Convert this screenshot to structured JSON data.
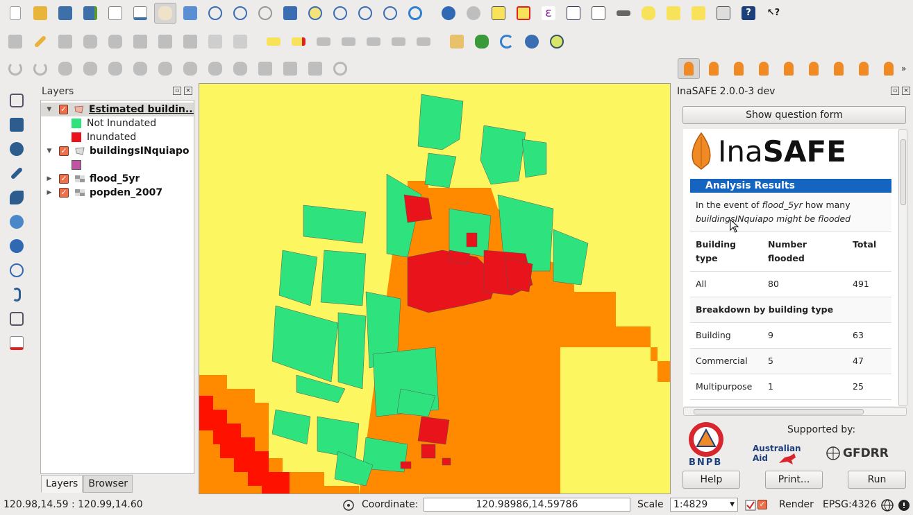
{
  "toolbar": {
    "row1": [
      "new-project-icon",
      "open-project-icon",
      "save-project-icon",
      "save-as-icon",
      "new-print-composer-icon",
      "composer-manager-icon",
      "pan-icon",
      "pan-to-selection-icon",
      "zoom-in-icon",
      "zoom-out-icon",
      "zoom-native-icon",
      "zoom-full-icon",
      "zoom-to-selection-icon",
      "zoom-to-layer-icon",
      "zoom-last-icon",
      "zoom-next-icon",
      "refresh-icon",
      "identify-icon",
      "action-icon",
      "select-features-icon",
      "deselect-icon",
      "field-calculator-icon",
      "attribute-table-icon",
      "statistics-icon",
      "measure-icon",
      "annotation-icon",
      "new-bookmark-icon",
      "show-bookmarks-icon",
      "text-annotation-icon",
      "help-icon",
      "whats-this-icon"
    ],
    "row2": [
      "current-edits-icon",
      "toggle-editing-icon",
      "save-edits-icon",
      "add-feature-icon",
      "move-feature-icon",
      "node-tool-icon",
      "delete-selected-icon",
      "cut-features-icon",
      "copy-features-icon",
      "paste-features-icon",
      "label-icon",
      "label-pin-icon",
      "label-highlight-icon",
      "label-show-hide-icon",
      "label-move-icon",
      "label-rotate-icon",
      "label-change-icon",
      "plugin-install-icon",
      "plugin-manager-icon",
      "python-console-icon",
      "georeferencer-icon"
    ],
    "row3": [
      "undo-icon",
      "redo-icon",
      "simplify-icon",
      "add-ring-icon",
      "add-part-icon",
      "fill-ring-icon",
      "delete-ring-icon",
      "delete-part-icon",
      "reshape-icon",
      "offset-curve-icon",
      "split-features-icon",
      "split-parts-icon",
      "merge-features-icon",
      "rotate-point-icon"
    ],
    "inasafe_row": [
      "inasafe-dock-icon",
      "keywords-icon",
      "impact-functions-icon",
      "options-icon",
      "minimum-needs-icon",
      "converter-icon",
      "batch-runner-icon",
      "osm-downloader-icon",
      "shakemap-icon"
    ]
  },
  "layers_panel": {
    "title": "Layers",
    "layers": [
      {
        "name": "Estimated buildin...",
        "expanded": true,
        "checked": true,
        "legend": [
          {
            "label": "Not Inundated",
            "color": "#2ee37e"
          },
          {
            "label": "Inundated",
            "color": "#e8131b"
          }
        ]
      },
      {
        "name": "buildingsINquiapo",
        "expanded": true,
        "checked": true,
        "legend": [
          {
            "label": "",
            "color": "#c054a3"
          }
        ]
      },
      {
        "name": "flood_5yr",
        "expanded": false,
        "checked": true
      },
      {
        "name": "popden_2007",
        "expanded": false,
        "checked": true
      }
    ],
    "tabs": [
      "Layers",
      "Browser"
    ]
  },
  "inasafe": {
    "title": "InaSAFE 2.0.0-3 dev",
    "question_button": "Show question form",
    "logo_regular": "Ina",
    "logo_bold": "SAFE",
    "analysis_header": "Analysis Results",
    "question": {
      "p1": "In the event of ",
      "hazard": "flood_5yr",
      "p2": " how many",
      "exposure": "buildingsINquiapo",
      "p3": " might be flooded"
    },
    "table": {
      "headers": [
        "Building type",
        "Number flooded",
        "Total"
      ],
      "all_row": [
        "All",
        "80",
        "491"
      ],
      "breakdown_label": "Breakdown by building type",
      "rows": [
        [
          "Building",
          "9",
          "63"
        ],
        [
          "Commercial",
          "5",
          "47"
        ],
        [
          "Multipurpose",
          "1",
          "25"
        ]
      ]
    },
    "supported_by": "Supported by:",
    "bnpb": "BNPB",
    "aus_aid": "Australian Aid",
    "gfdrr": "GFDRR",
    "buttons": {
      "help": "Help",
      "print": "Print...",
      "run": "Run"
    }
  },
  "statusbar": {
    "extent": "120.98,14.59 : 120.99,14.60",
    "coordinate_label": "Coordinate:",
    "coordinate_value": "120.98986,14.59786",
    "scale_label": "Scale",
    "scale_value": "1:4829",
    "render_label": "Render",
    "crs": "EPSG:4326"
  },
  "map": {
    "background_color": "#fcf760",
    "flood_color": "#ff8a00",
    "deep_flood_color": "#ff1100",
    "not_inundated_color": "#2ee37e",
    "inundated_color": "#e8131b"
  }
}
